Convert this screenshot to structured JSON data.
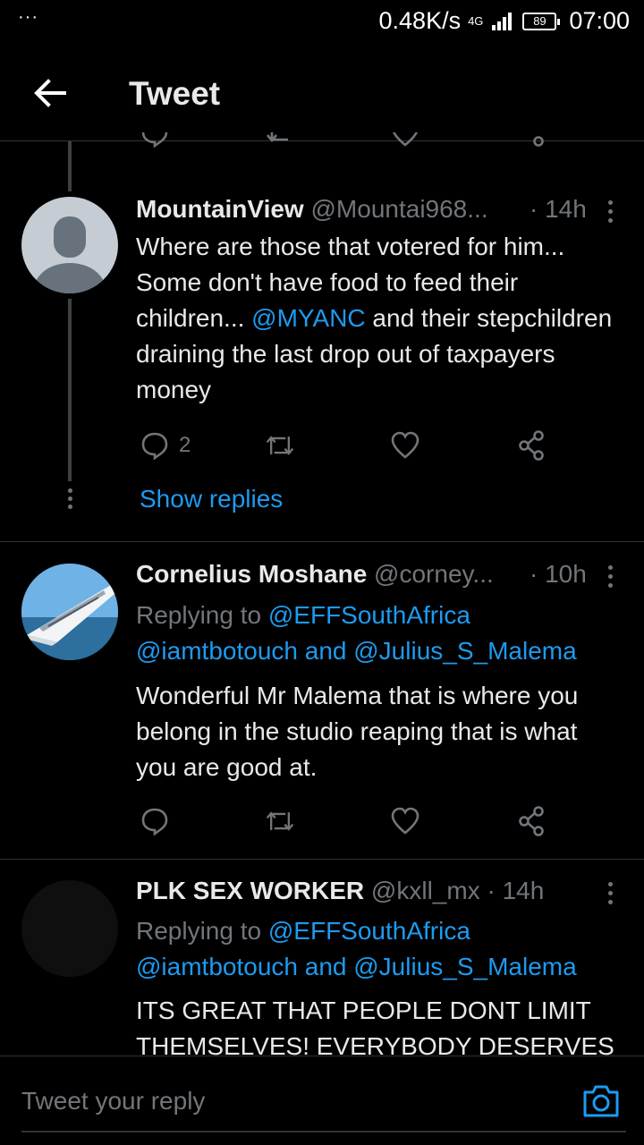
{
  "statusbar": {
    "dots": "···",
    "speed": "0.48K/s",
    "network": "4G",
    "battery": "89",
    "time": "07:00"
  },
  "header": {
    "title": "Tweet"
  },
  "tweets": [
    {
      "name": "MountainView",
      "handle": "@Mountai968...",
      "time": "· 14h",
      "body_parts": [
        "Where are those that votered for him... Some don't have food to feed their children... ",
        "@MYANC",
        " and their stepchildren draining the last drop out of taxpayers money"
      ],
      "reply_count": "2",
      "show_replies": "Show replies"
    },
    {
      "name": "Cornelius Moshane",
      "handle": "@corney...",
      "time": "· 10h",
      "replying_prefix": "Replying to ",
      "replying_to_1": "@EFFSouthAfrica",
      "replying_to_2": "@iamtbotouch",
      "replying_and": " and ",
      "replying_to_3": "@Julius_S_Malema",
      "body": "Wonderful Mr Malema that is where you belong in the studio reaping that is what you are good at."
    },
    {
      "name": "PLK SEX WORKER",
      "handle": "@kxll_mx",
      "time": "· 14h",
      "replying_prefix": "Replying to ",
      "replying_to_1": "@EFFSouthAfrica",
      "replying_to_2": "@iamtbotouch",
      "replying_and": " and ",
      "replying_to_3": "@Julius_S_Malema",
      "body": "ITS GREAT THAT PEOPLE DONT LIMIT THEMSELVES! EVERYBODY DESERVES"
    }
  ],
  "reply_bar": {
    "placeholder": "Tweet your reply"
  },
  "colors": {
    "accent": "#1d9bf0",
    "muted": "#71767b",
    "text": "#e7e9ea",
    "background": "#000000"
  },
  "icons": [
    "back-arrow-icon",
    "reply-icon",
    "retweet-icon",
    "like-icon",
    "share-icon",
    "more-icon",
    "camera-icon"
  ]
}
